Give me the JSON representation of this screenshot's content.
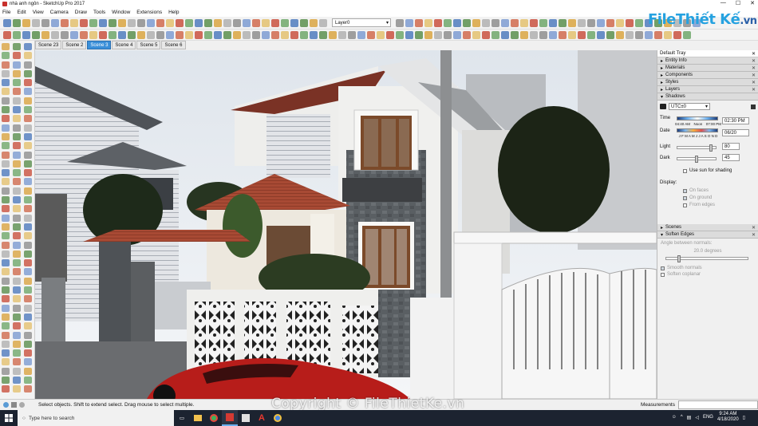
{
  "window": {
    "title": "nhà anh ngôn - SketchUp Pro 2017",
    "min": "—",
    "max": "☐",
    "close": "✕"
  },
  "menu": [
    "File",
    "Edit",
    "View",
    "Camera",
    "Draw",
    "Tools",
    "Window",
    "Extensions",
    "Help"
  ],
  "toolbar": {
    "layer_label": "Layer0"
  },
  "logo": {
    "main": "FileThiết Kế",
    "suffix": ".vn"
  },
  "scenes": [
    {
      "label": "Scene 23",
      "active": false
    },
    {
      "label": "Scene 2",
      "active": false
    },
    {
      "label": "Scene 3",
      "active": true
    },
    {
      "label": "Scene 4",
      "active": false
    },
    {
      "label": "Scene 5",
      "active": false
    },
    {
      "label": "Scene 6",
      "active": false
    }
  ],
  "tray": {
    "title": "Default Tray",
    "close": "✕",
    "panels_top": [
      "Entity Info",
      "Materials",
      "Components",
      "Styles",
      "Layers"
    ],
    "shadows": {
      "title": "Shadows",
      "timezone": "UTC±0",
      "time_label": "Time",
      "time_marks": [
        "04:40 AM",
        "Noon",
        "07:00 PM"
      ],
      "time_value": "02:30 PM",
      "date_label": "Date",
      "months": "J F M A M J J A S O N D",
      "date_value": "06/20",
      "light_label": "Light",
      "light_value": "80",
      "dark_label": "Dark",
      "dark_value": "45",
      "use_sun": "Use sun for shading",
      "display_label": "Display:",
      "on_faces": "On faces",
      "on_ground": "On ground",
      "from_edges": "From edges"
    },
    "scenes_panel": "Scenes",
    "soften": {
      "title": "Soften Edges",
      "angle_label": "Angle between normals:",
      "angle_value": "20.0",
      "angle_unit": "degrees",
      "smooth": "Smooth normals",
      "coplanar": "Soften coplanar"
    }
  },
  "status": {
    "message": "Select objects. Shift to extend select. Drag mouse to select multiple.",
    "measurements_label": "Measurements"
  },
  "taskbar": {
    "search_placeholder": "Type here to search",
    "time": "9:24 AM",
    "date": "4/18/2020",
    "lang": "ENG"
  },
  "copyright": "Copyright © FileThietKe.vn"
}
